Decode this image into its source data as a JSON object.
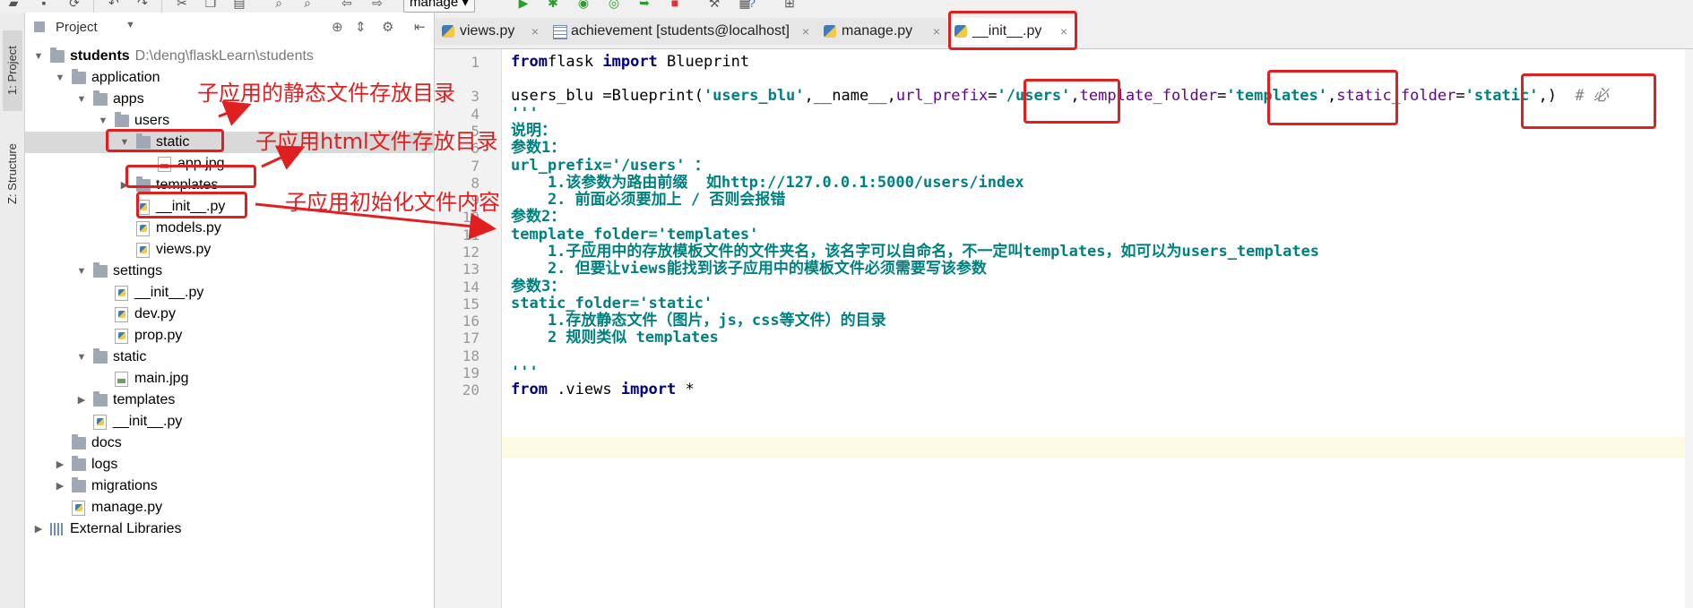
{
  "toolbar": {
    "run_config": "manage"
  },
  "left_strip": {
    "project_tab": "1: Project",
    "structure_tab": "Z: Structure"
  },
  "project_panel": {
    "title": "Project",
    "tree": [
      {
        "label": "students",
        "hint": "D:\\deng\\flaskLearn\\students",
        "type": "folder",
        "depth": 0,
        "expanded": true,
        "bold": true
      },
      {
        "label": "application",
        "type": "folder",
        "depth": 1,
        "expanded": true
      },
      {
        "label": "apps",
        "type": "folder",
        "depth": 2,
        "expanded": true
      },
      {
        "label": "users",
        "type": "folder",
        "depth": 3,
        "expanded": true
      },
      {
        "label": "static",
        "type": "folder",
        "depth": 4,
        "expanded": true,
        "selected": true
      },
      {
        "label": "app.jpg",
        "type": "image",
        "depth": 5
      },
      {
        "label": "templates",
        "type": "folder",
        "depth": 4,
        "expanded": false
      },
      {
        "label": "__init__.py",
        "type": "python",
        "depth": 4
      },
      {
        "label": "models.py",
        "type": "python",
        "depth": 4
      },
      {
        "label": "views.py",
        "type": "python",
        "depth": 4
      },
      {
        "label": "settings",
        "type": "folder",
        "depth": 2,
        "expanded": true
      },
      {
        "label": "__init__.py",
        "type": "python",
        "depth": 3
      },
      {
        "label": "dev.py",
        "type": "python",
        "depth": 3
      },
      {
        "label": "prop.py",
        "type": "python",
        "depth": 3
      },
      {
        "label": "static",
        "type": "folder",
        "depth": 2,
        "expanded": true
      },
      {
        "label": "main.jpg",
        "type": "image",
        "depth": 3
      },
      {
        "label": "templates",
        "type": "folder",
        "depth": 2,
        "expanded": false
      },
      {
        "label": "__init__.py",
        "type": "python",
        "depth": 2
      },
      {
        "label": "docs",
        "type": "folder",
        "depth": 1
      },
      {
        "label": "logs",
        "type": "folder",
        "depth": 1,
        "expanded": false
      },
      {
        "label": "migrations",
        "type": "folder",
        "depth": 1,
        "expanded": false
      },
      {
        "label": "manage.py",
        "type": "python",
        "depth": 1
      },
      {
        "label": "External Libraries",
        "type": "libs",
        "depth": 0,
        "expanded": false
      }
    ]
  },
  "editor_tabs": [
    {
      "label": "views.py",
      "type": "python",
      "active": false
    },
    {
      "label": "achievement [students@localhost]",
      "type": "table",
      "active": false
    },
    {
      "label": "manage.py",
      "type": "python",
      "active": false
    },
    {
      "label": "__init__.py",
      "type": "python",
      "active": true
    }
  ],
  "code_lines": [
    {
      "n": "1",
      "tokens": [
        [
          "kw",
          "from"
        ],
        [
          "",
          "flask "
        ],
        [
          "kw",
          "import"
        ],
        [
          "",
          " Blueprint"
        ]
      ]
    },
    {
      "n": "",
      "tokens": []
    },
    {
      "n": "3",
      "tokens": [
        [
          "",
          "users_blu =Blueprint("
        ],
        [
          "str",
          "'users_blu'"
        ],
        [
          "",
          ",__name__,"
        ],
        [
          "prm",
          "url_prefix"
        ],
        [
          "",
          "="
        ],
        [
          "str",
          "'/users'"
        ],
        [
          "",
          ","
        ],
        [
          "prm",
          "template_folder"
        ],
        [
          "",
          "="
        ],
        [
          "str",
          "'templates'"
        ],
        [
          "",
          ","
        ],
        [
          "prm",
          "static_folder"
        ],
        [
          "",
          "="
        ],
        [
          "str",
          "'static'"
        ],
        [
          "",
          ",)  "
        ],
        [
          "cmt",
          "# 必"
        ]
      ]
    },
    {
      "n": "4",
      "tokens": [
        [
          "doc",
          "'''"
        ]
      ]
    },
    {
      "n": "5",
      "tokens": [
        [
          "doc",
          "说明："
        ]
      ]
    },
    {
      "n": "6",
      "tokens": [
        [
          "doc",
          "参数1："
        ]
      ]
    },
    {
      "n": "7",
      "tokens": [
        [
          "doc",
          "url_prefix='/users' ："
        ]
      ]
    },
    {
      "n": "8",
      "tokens": [
        [
          "doc",
          "    1.该参数为路由前缀  如http://127.0.0.1:5000/users/index"
        ]
      ]
    },
    {
      "n": "9",
      "tokens": [
        [
          "doc",
          "    2. 前面必须要加上 / 否则会报错"
        ]
      ]
    },
    {
      "n": "10",
      "tokens": [
        [
          "doc",
          "参数2："
        ]
      ]
    },
    {
      "n": "11",
      "tokens": [
        [
          "doc",
          "template_folder='templates'"
        ]
      ]
    },
    {
      "n": "12",
      "tokens": [
        [
          "doc",
          "    1.子应用中的存放模板文件的文件夹名，该名字可以自命名，不一定叫templates，如可以为users_templates"
        ]
      ]
    },
    {
      "n": "13",
      "tokens": [
        [
          "doc",
          "    2. 但要让views能找到该子应用中的模板文件必须需要写该参数"
        ]
      ]
    },
    {
      "n": "14",
      "tokens": [
        [
          "doc",
          "参数3："
        ]
      ]
    },
    {
      "n": "15",
      "tokens": [
        [
          "doc",
          "static_folder='static'"
        ]
      ]
    },
    {
      "n": "16",
      "tokens": [
        [
          "doc",
          "    1.存放静态文件（图片，js，css等文件）的目录"
        ]
      ]
    },
    {
      "n": "17",
      "tokens": [
        [
          "doc",
          "    2 规则类似 templates"
        ]
      ]
    },
    {
      "n": "18",
      "tokens": []
    },
    {
      "n": "19",
      "tokens": [
        [
          "doc",
          "'''"
        ]
      ]
    },
    {
      "n": "20",
      "tokens": [
        [
          "kw",
          "from"
        ],
        [
          "",
          " .views "
        ],
        [
          "kw",
          "import"
        ],
        [
          "",
          " *"
        ]
      ]
    }
  ],
  "annotations": {
    "static_dir": "子应用的静态文件存放目录",
    "html_dir": "子应用html文件存放目录",
    "init_file": "子应用初始化文件内容"
  },
  "colors": {
    "annotation_red": "#e02020",
    "keyword": "#000080",
    "string": "#008080",
    "param": "#660099"
  }
}
